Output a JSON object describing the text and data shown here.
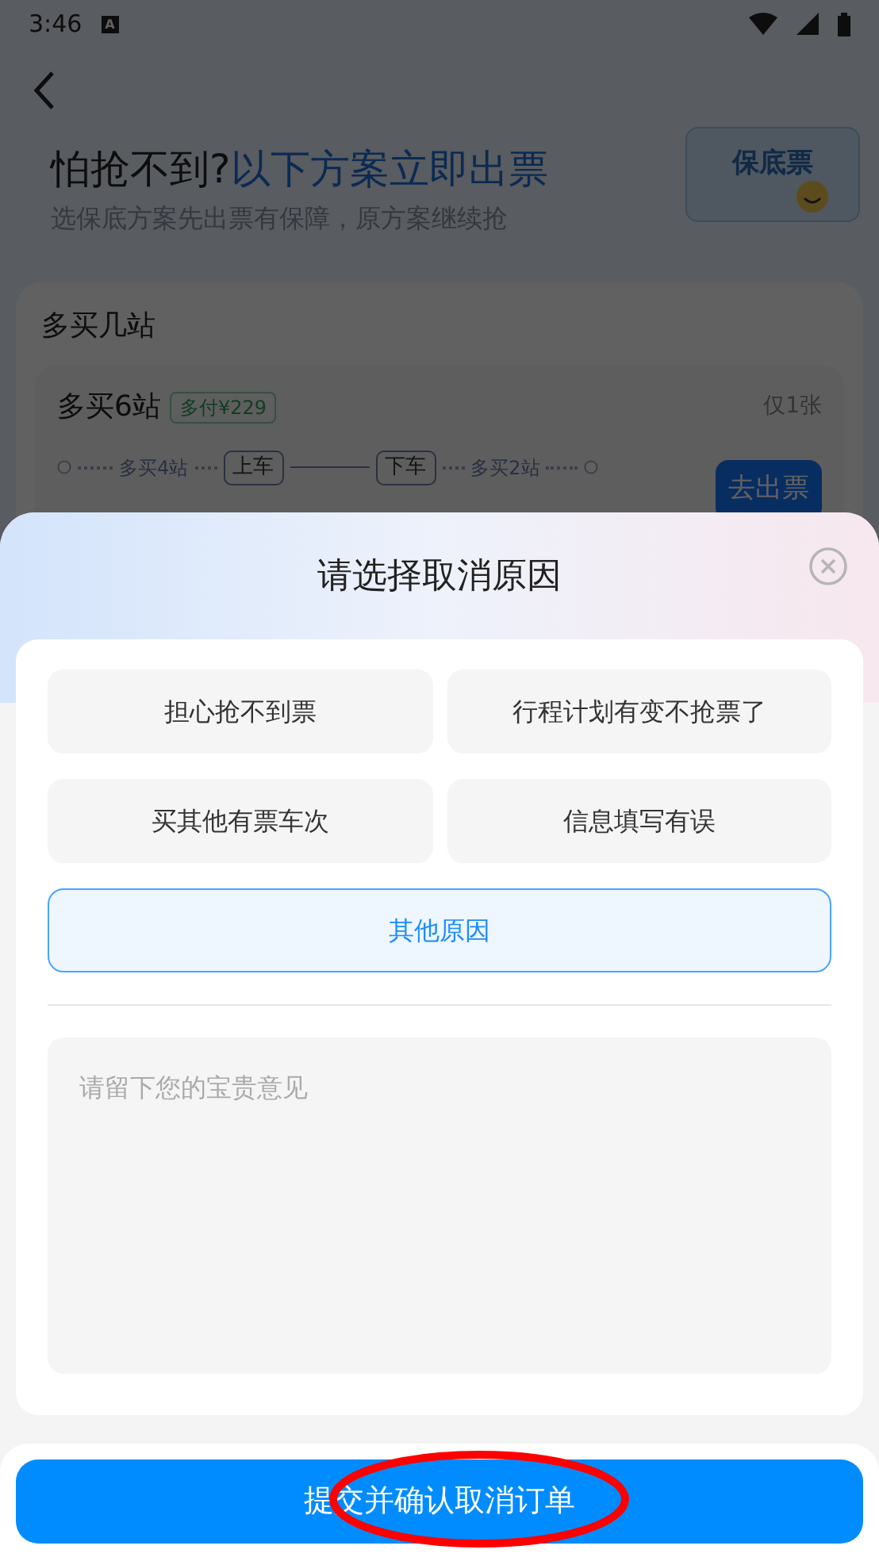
{
  "status_bar": {
    "time": "3:46",
    "notification": "A"
  },
  "page": {
    "title_dark": "怕抢不到?",
    "title_blue": "以下方案立即出票",
    "subtitle": "选保底方案先出票有保障，原方案继续抢",
    "art_text": "保底票",
    "card": {
      "title": "多买几站",
      "option": {
        "name": "多买6站",
        "tag": "多付¥229",
        "remaining": "仅1张",
        "extra_before": "多买4站",
        "board": "上车",
        "alight": "下车",
        "extra_after": "多买2站",
        "action": "去出票"
      }
    }
  },
  "sheet": {
    "title": "请选择取消原因",
    "reasons": [
      {
        "label": "担心抢不到票",
        "selected": false
      },
      {
        "label": "行程计划有变不抢票了",
        "selected": false
      },
      {
        "label": "买其他有票车次",
        "selected": false
      },
      {
        "label": "信息填写有误",
        "selected": false
      },
      {
        "label": "其他原因",
        "selected": true
      }
    ],
    "feedback": {
      "placeholder": "请留下您的宝贵意见"
    },
    "submit": "提交并确认取消订单"
  }
}
